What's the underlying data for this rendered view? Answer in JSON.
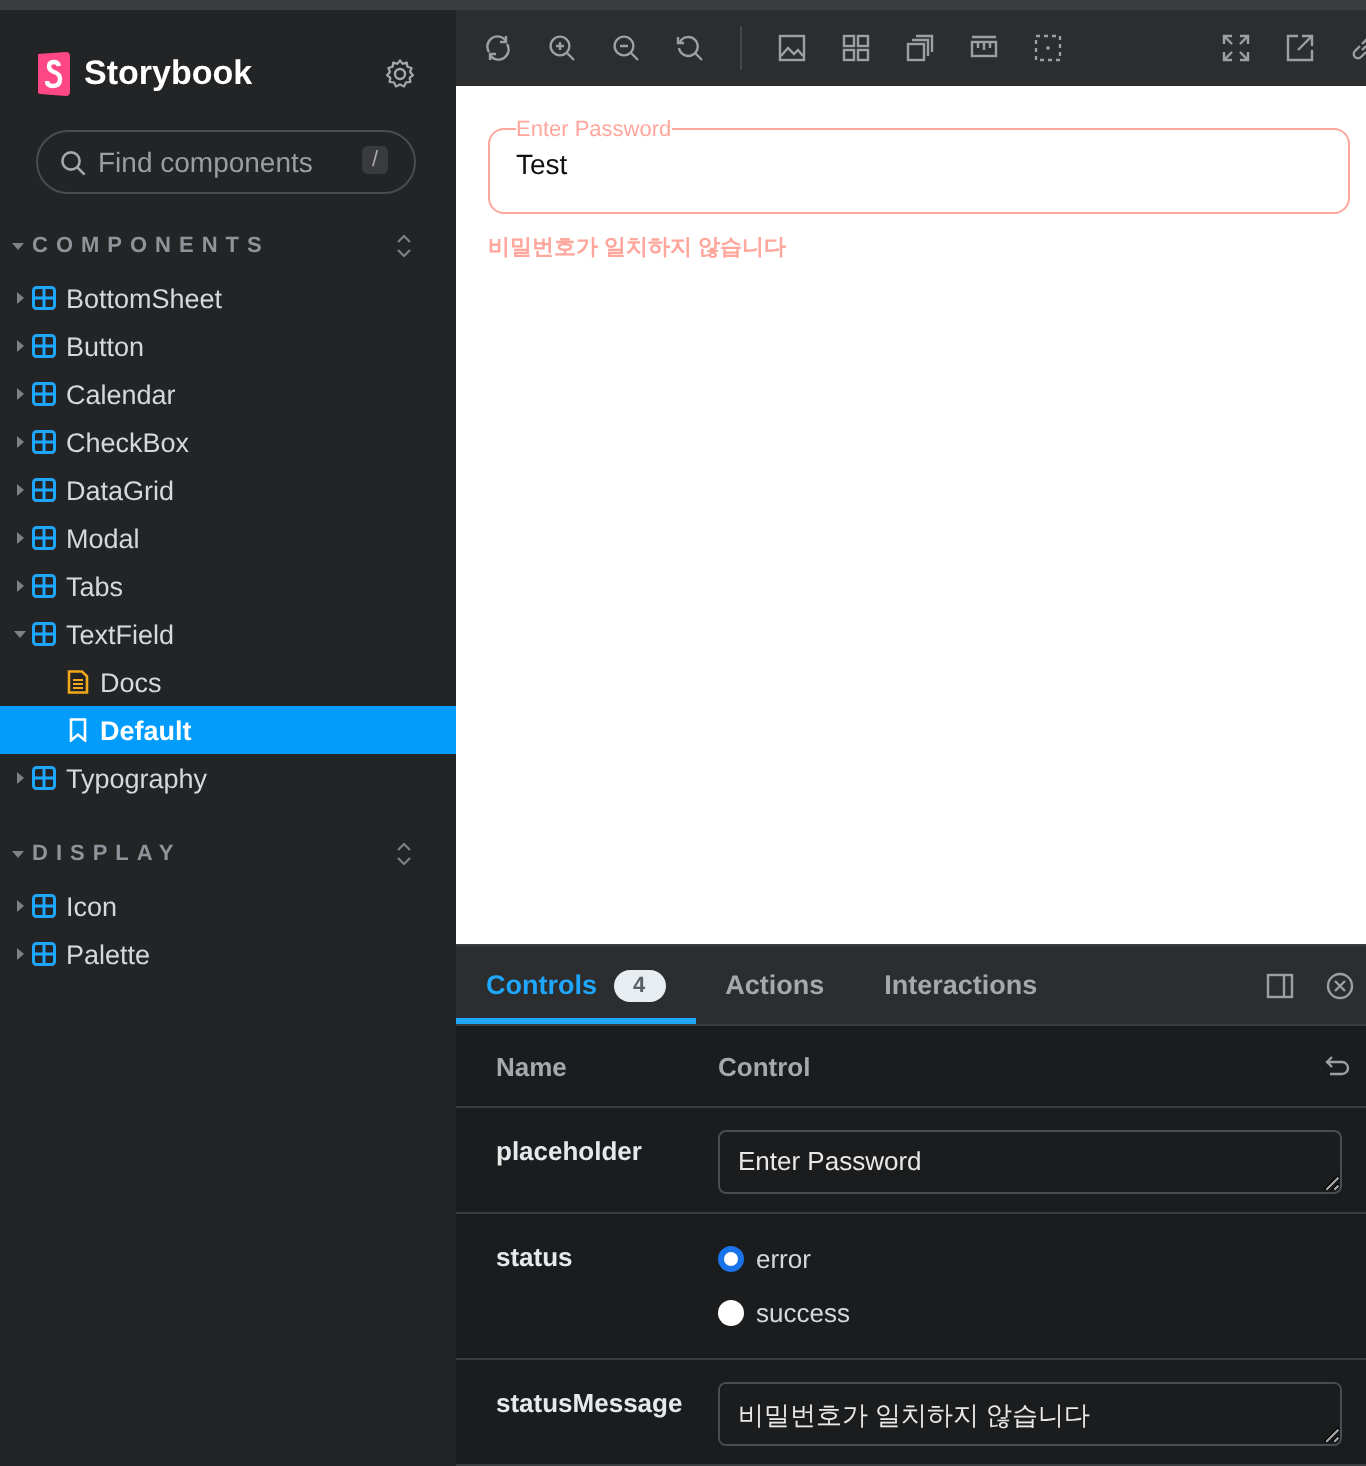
{
  "sidebar": {
    "app_title": "Storybook",
    "search": {
      "placeholder": "Find components",
      "shortcut": "/"
    },
    "sections": [
      {
        "title": "COMPONENTS",
        "expanded": true,
        "items": [
          {
            "label": "BottomSheet",
            "kind": "component",
            "expanded": false,
            "selected": false
          },
          {
            "label": "Button",
            "kind": "component",
            "expanded": false,
            "selected": false
          },
          {
            "label": "Calendar",
            "kind": "component",
            "expanded": false,
            "selected": false
          },
          {
            "label": "CheckBox",
            "kind": "component",
            "expanded": false,
            "selected": false
          },
          {
            "label": "DataGrid",
            "kind": "component",
            "expanded": false,
            "selected": false
          },
          {
            "label": "Modal",
            "kind": "component",
            "expanded": false,
            "selected": false
          },
          {
            "label": "Tabs",
            "kind": "component",
            "expanded": false,
            "selected": false
          },
          {
            "label": "TextField",
            "kind": "component",
            "expanded": true,
            "selected": false,
            "children": [
              {
                "label": "Docs",
                "kind": "docs",
                "selected": false
              },
              {
                "label": "Default",
                "kind": "story",
                "selected": true
              }
            ]
          },
          {
            "label": "Typography",
            "kind": "component",
            "expanded": false,
            "selected": false
          }
        ]
      },
      {
        "title": "DISPLAY",
        "expanded": true,
        "items": [
          {
            "label": "Icon",
            "kind": "component",
            "expanded": false,
            "selected": false
          },
          {
            "label": "Palette",
            "kind": "component",
            "expanded": false,
            "selected": false
          }
        ]
      }
    ]
  },
  "preview": {
    "text_field": {
      "label": "Enter Password",
      "value": "Test",
      "error": true,
      "message": "비밀번호가 일치하지 않습니다"
    }
  },
  "addons": {
    "tabs": [
      {
        "label": "Controls",
        "badge": "4",
        "selected": true
      },
      {
        "label": "Actions",
        "selected": false
      },
      {
        "label": "Interactions",
        "selected": false
      }
    ],
    "columns": [
      "Name",
      "Control"
    ],
    "rows": [
      {
        "name": "placeholder",
        "kind": "text",
        "value": "Enter Password"
      },
      {
        "name": "status",
        "kind": "radio",
        "options": [
          {
            "label": "error",
            "selected": true
          },
          {
            "label": "success",
            "selected": false
          }
        ]
      },
      {
        "name": "statusMessage",
        "kind": "text",
        "value": "비밀번호가 일치하지 않습니다"
      }
    ]
  }
}
